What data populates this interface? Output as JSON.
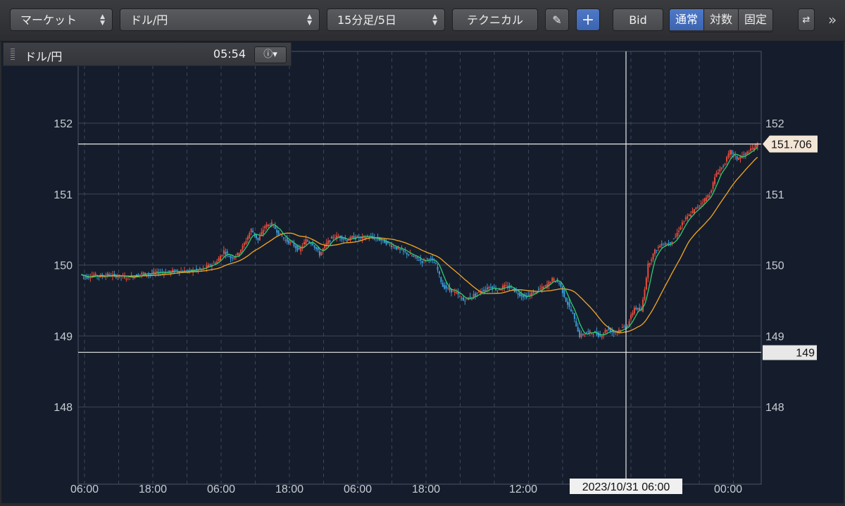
{
  "toolbar": {
    "market_label": "マーケット",
    "pair_label": "ドル/円",
    "timeframe_label": "15分足/5日",
    "technical_label": "テクニカル",
    "bid_label": "Bid",
    "scale_modes": [
      "通常",
      "対数",
      "固定"
    ],
    "scale_mode_active": "通常",
    "more_label": "»"
  },
  "info_bar": {
    "symbol": "ドル/円",
    "time": "05:54"
  },
  "chart_data": {
    "type": "candlestick",
    "title": "",
    "xlabel": "",
    "ylabel": "",
    "ylim": [
      147,
      153.0
    ],
    "yticks": [
      148,
      149,
      150,
      151,
      152
    ],
    "x_tick_labels": [
      "06:00",
      "18:00",
      "06:00",
      "18:00",
      "06:00",
      "18:00",
      "12:00",
      "00:00"
    ],
    "crosshair_time_label": "2023/10/31 06:00",
    "current_price_label": "151.706",
    "current_price": 151.706,
    "horizontal_line_label": "149",
    "horizontal_line_value": 148.77,
    "close_path": [
      149.87,
      149.83,
      149.86,
      149.84,
      149.86,
      149.85,
      149.84,
      149.82,
      149.85,
      149.88,
      149.87,
      149.89,
      149.9,
      149.9,
      149.92,
      149.91,
      149.92,
      149.93,
      149.95,
      150.0,
      150.05,
      150.2,
      150.1,
      150.15,
      150.3,
      150.5,
      150.35,
      150.55,
      150.58,
      150.45,
      150.35,
      150.3,
      150.2,
      150.35,
      150.3,
      150.15,
      150.3,
      150.4,
      150.4,
      150.35,
      150.4,
      150.38,
      150.4,
      150.38,
      150.35,
      150.3,
      150.25,
      150.2,
      150.15,
      150.1,
      150.05,
      150.1,
      150.0,
      149.7,
      149.65,
      149.6,
      149.5,
      149.55,
      149.6,
      149.65,
      149.7,
      149.65,
      149.7,
      149.68,
      149.6,
      149.55,
      149.6,
      149.65,
      149.7,
      149.8,
      149.75,
      149.5,
      149.3,
      149.0,
      149.05,
      149.05,
      149.0,
      149.1,
      149.05,
      149.1,
      149.15,
      149.4,
      149.35,
      150.0,
      150.2,
      150.3,
      150.3,
      150.4,
      150.6,
      150.7,
      150.8,
      150.9,
      151.0,
      151.3,
      151.4,
      151.6,
      151.5,
      151.55,
      151.62,
      151.706
    ],
    "ma_fast_color": "#2ecc71",
    "ma_slow_color": "#f5a623",
    "up_color": "#e74c3c",
    "down_color": "#3a9ad9"
  }
}
